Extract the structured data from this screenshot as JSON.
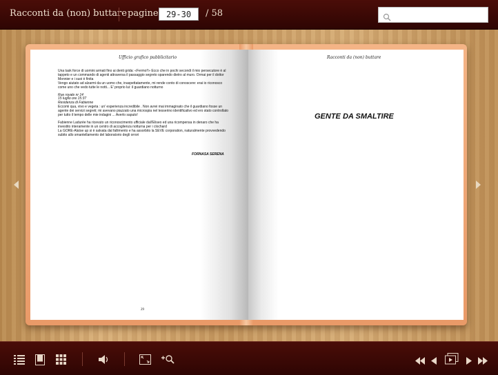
{
  "toolbar": {
    "title": "Racconti da (non) buttare",
    "pages_label": "pagine:",
    "page_value": "29-30",
    "total": "/ 58"
  },
  "book": {
    "left_header": "Ufficio grafico pubblicitario",
    "right_header": "Racconti da (non) buttare",
    "paragraphs": [
      "Una task force di uomini armati fino ai denti grida: «Fermo!!» Ecco che in pochi secondi il mio persecutore è al tappeto e un commando di agenti attraversa il passaggio segreto sparendo dietro al muro. Ormai per il dottor Monnier e i suoi è finita",
      "Vengo aiutato ad alzarmi da un uomo che, inaspettatamente, mi rende conto di conoscere: erai io riconosco come uno che vedo tutte le notti... E' proprio lui: il guardiano notturno"
    ],
    "report_heading": "Rue royale nr 14",
    "report_date": "15 luglio ore 15:37",
    "report_place": "Residenza di Fabienne",
    "report_text": "Eccomi qua, vivo e vegeta : un' esperienza incredibile . Non avrei mai immaginato che il guardiano fosse un agente dei servizi segreti; mi avevano piazzato una microspia nel tesserino identificativo ed ero stato controllato per tutto il tempo delle mie indagini ... Averlo saputo!",
    "closing_paragraphs": [
      "Fabienne Ladurée ha ricevuto un riconoscimento ufficiale dall'Eliseo ed una ricompensa in denaro che ha investito interamente in un centro di accoglienza notturna per i clochard",
      "La GORE-Alaïse up si è salvata dal fallimento e ha assorbito la SEVE corporation, naturalmente provvedendo subito allo smantellamento del laboratorio degli orrori"
    ],
    "signature": "FORNASA SERENA",
    "left_page_number": "29",
    "chapter_title": "GENTE DA SMALTIRE"
  },
  "icons": {
    "search": "magnifier-icon",
    "toc": "table-of-contents-icon",
    "bookmark": "bookmark-icon",
    "thumbnails": "thumbnails-grid-icon",
    "sound": "speaker-icon",
    "fullscreen": "fullscreen-icon",
    "zoom": "zoom-in-icon",
    "first": "first-page-icon",
    "prev": "previous-page-icon",
    "slideshow": "slideshow-icon",
    "next": "next-page-icon",
    "last": "last-page-icon"
  },
  "colors": {
    "bar": "#3a0705",
    "cover": "#eea272",
    "wood": "#c9a06a"
  }
}
